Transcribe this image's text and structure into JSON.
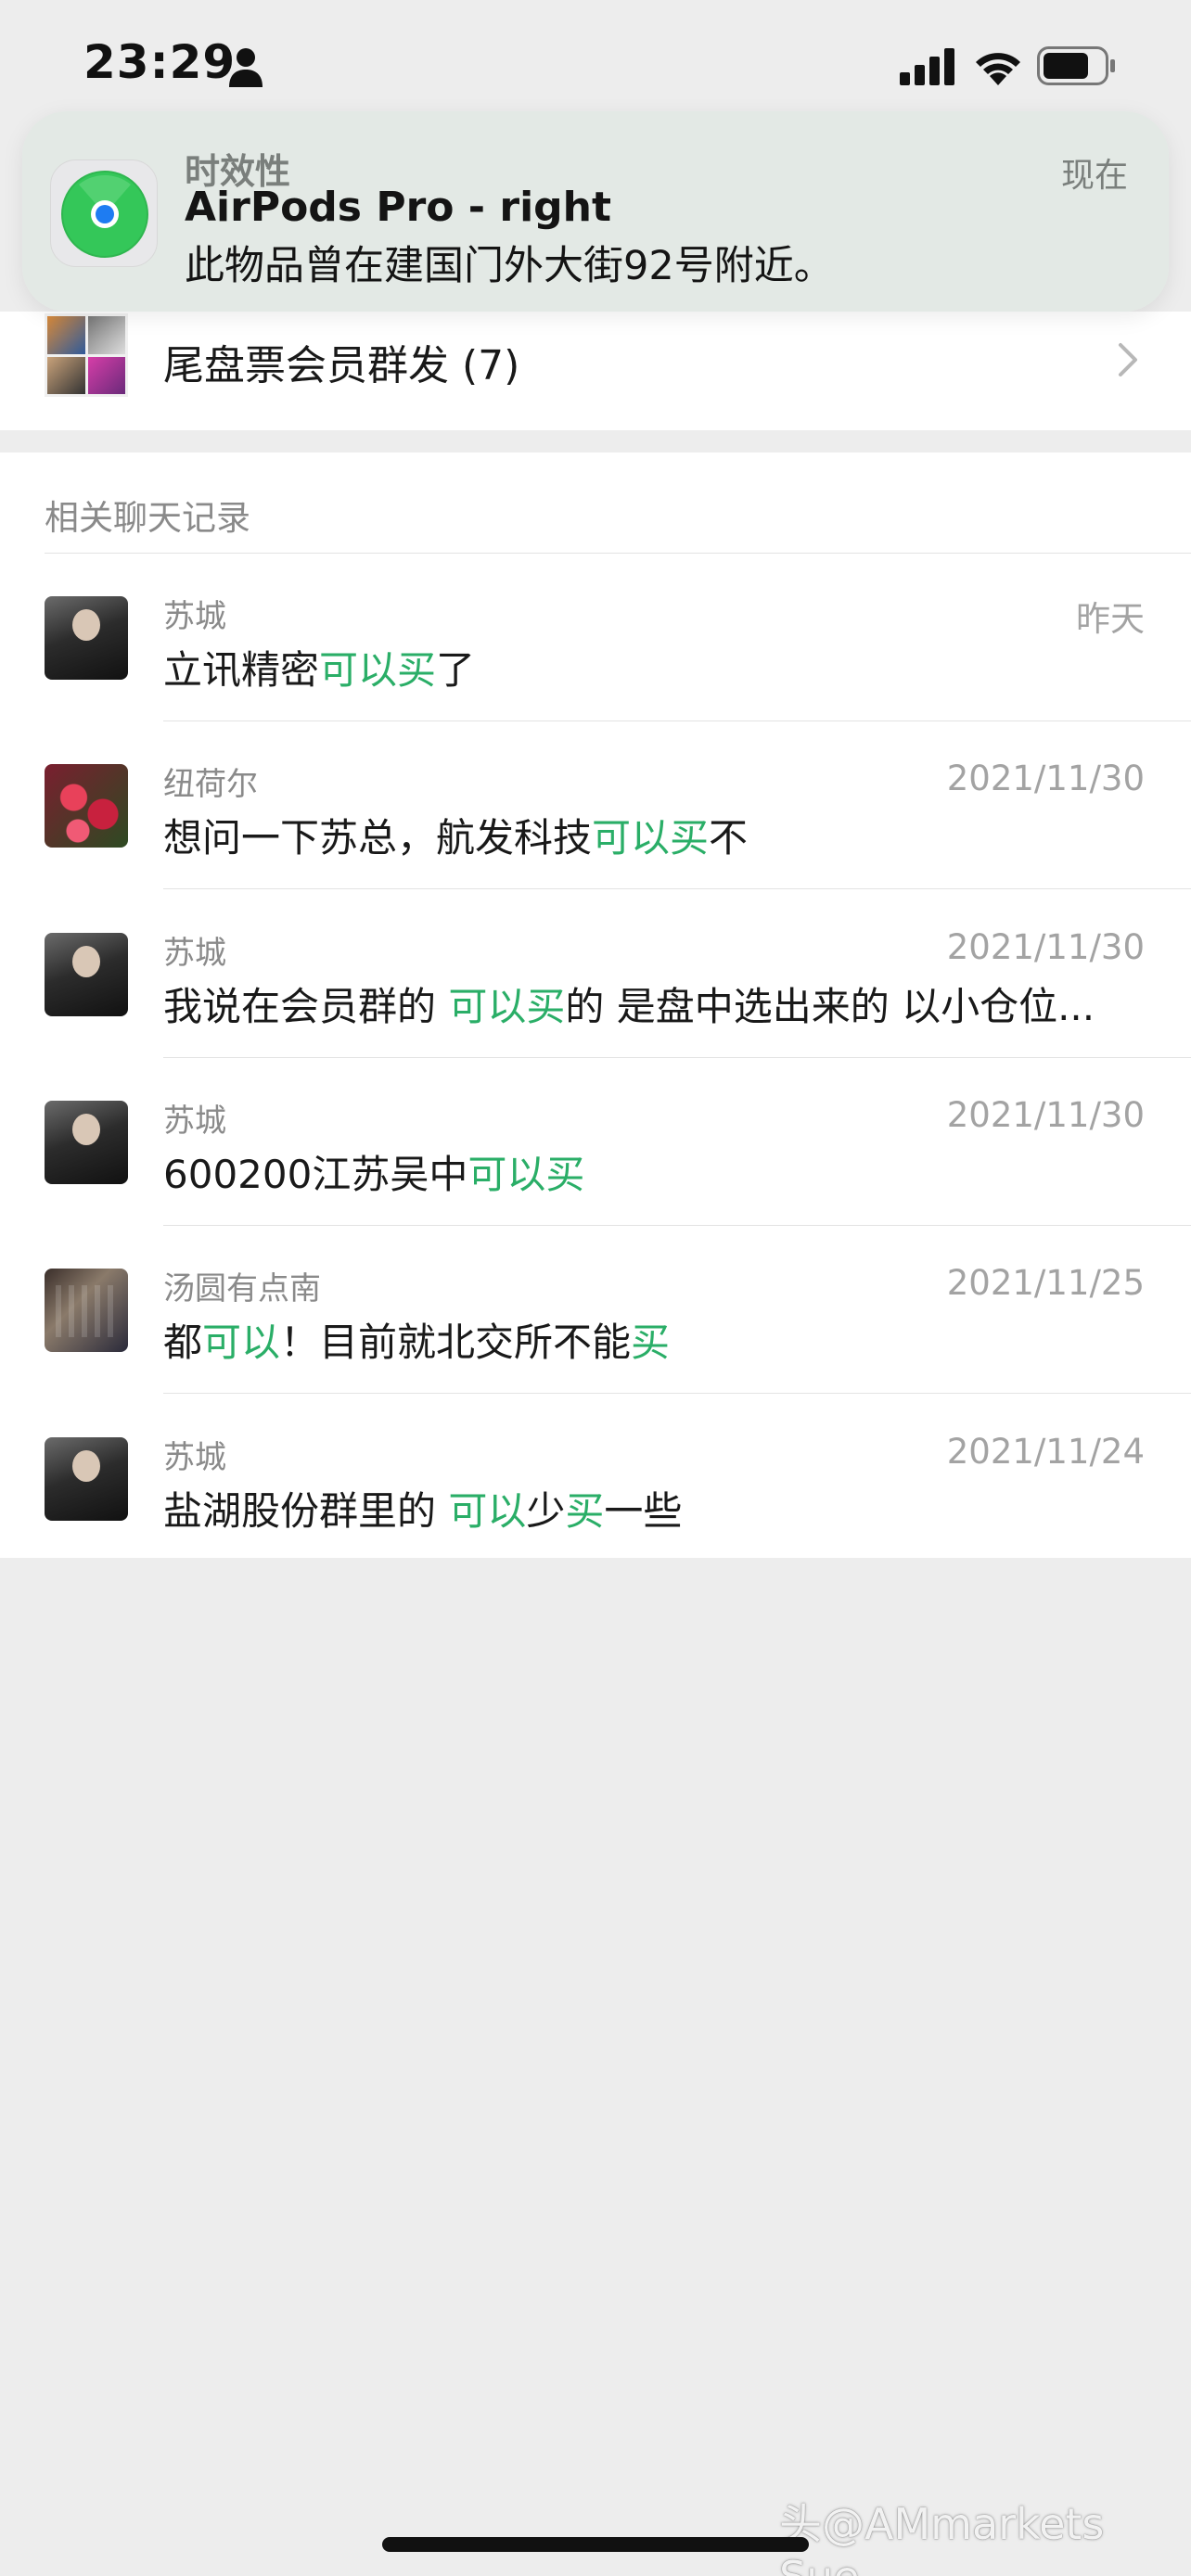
{
  "status_bar": {
    "time": "23:29",
    "icons": [
      "person-icon",
      "signal-icon",
      "wifi-icon",
      "battery-icon"
    ]
  },
  "notification": {
    "app_icon": "find-my-icon",
    "category": "时效性",
    "time": "现在",
    "title": "AirPods Pro - right",
    "body": "此物品曾在建国门外大街92号附近。"
  },
  "group_row": {
    "name": "尾盘票会员群发 (7)",
    "icon": "chevron-right-icon"
  },
  "section": {
    "header": "相关聊天记录"
  },
  "chats": [
    {
      "sender": "苏城",
      "date": "昨天",
      "avatar": "avatar-dark",
      "segments": [
        {
          "text": "立讯精密",
          "hl": false
        },
        {
          "text": "可以买",
          "hl": true
        },
        {
          "text": "了",
          "hl": false
        }
      ]
    },
    {
      "sender": "纽荷尔",
      "date": "2021/11/30",
      "avatar": "avatar-flower",
      "segments": [
        {
          "text": "想问一下苏总，航发科技",
          "hl": false
        },
        {
          "text": "可以买",
          "hl": true
        },
        {
          "text": "不",
          "hl": false
        }
      ]
    },
    {
      "sender": "苏城",
      "date": "2021/11/30",
      "avatar": "avatar-dark",
      "segments": [
        {
          "text": "我说在会员群的 ",
          "hl": false
        },
        {
          "text": "可以买",
          "hl": true
        },
        {
          "text": "的 是盘中选出来的 以小仓位...",
          "hl": false
        }
      ]
    },
    {
      "sender": "苏城",
      "date": "2021/11/30",
      "avatar": "avatar-dark",
      "segments": [
        {
          "text": "600200江苏吴中",
          "hl": false
        },
        {
          "text": "可以买",
          "hl": true
        }
      ]
    },
    {
      "sender": "汤圆有点南",
      "date": "2021/11/25",
      "avatar": "avatar-group",
      "segments": [
        {
          "text": "都",
          "hl": false
        },
        {
          "text": "可以",
          "hl": true
        },
        {
          "text": "！目前就北交所不能",
          "hl": false
        },
        {
          "text": "买",
          "hl": true
        }
      ]
    },
    {
      "sender": "苏城",
      "date": "2021/11/24",
      "avatar": "avatar-dark",
      "segments": [
        {
          "text": "盐湖股份群里的 ",
          "hl": false
        },
        {
          "text": "可以",
          "hl": true
        },
        {
          "text": "少",
          "hl": false
        },
        {
          "text": "买",
          "hl": true
        },
        {
          "text": "一些",
          "hl": false
        }
      ]
    }
  ],
  "colors": {
    "highlight": "#2aae67",
    "background": "#ededed",
    "card": "#ffffff"
  },
  "watermark": "头@AMmarkets Sue"
}
